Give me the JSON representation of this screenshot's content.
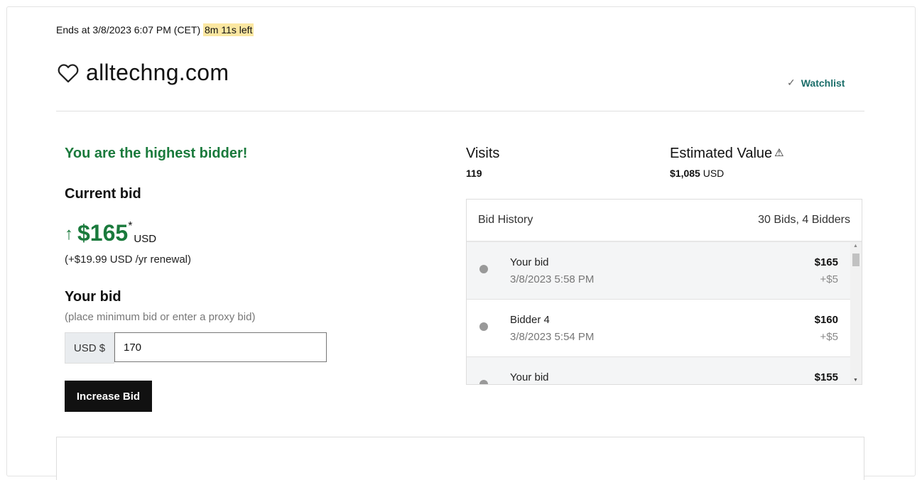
{
  "auction": {
    "ends_prefix": "Ends at 3/8/2023 6:07 PM (CET)",
    "time_left": "8m 11s left",
    "domain": "alltechng.com",
    "watchlist_label": "Watchlist",
    "watchlist_check": "✓"
  },
  "bid_status": {
    "message": "You are the highest bidder!",
    "current_bid_label": "Current bid",
    "arrow": "↑",
    "current_bid_amount": "$165",
    "asterisk": "*",
    "currency": "USD",
    "renewal": "(+$19.99 USD /yr renewal)"
  },
  "your_bid": {
    "label": "Your bid",
    "hint": "(place minimum bid or enter a proxy bid)",
    "prefix": "USD $",
    "value": "170",
    "button_label": "Increase Bid"
  },
  "stats": {
    "visits_label": "Visits",
    "visits_value": "119",
    "estimated_label": "Estimated Value",
    "estimated_amount": "$1,085",
    "estimated_currency": "USD",
    "warning_glyph": "⚠"
  },
  "history": {
    "title": "Bid History",
    "summary": "30 Bids, 4 Bidders",
    "rows": [
      {
        "bidder": "Your bid",
        "time": "3/8/2023 5:58 PM",
        "amount": "$165",
        "increment": "+$5"
      },
      {
        "bidder": "Bidder 4",
        "time": "3/8/2023 5:54 PM",
        "amount": "$160",
        "increment": "+$5"
      },
      {
        "bidder": "Your bid",
        "time": "",
        "amount": "$155",
        "increment": ""
      }
    ],
    "scroll_up": "▲",
    "scroll_down": "▼"
  }
}
